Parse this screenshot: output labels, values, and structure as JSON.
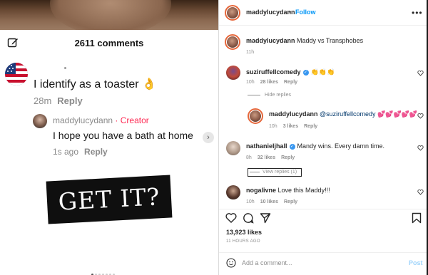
{
  "tiktok": {
    "comments_count": "2611 comments",
    "comment1": {
      "text": "I identify as a toaster 👌",
      "time": "28m",
      "reply_label": "Reply"
    },
    "comment2": {
      "author": "maddylucydann",
      "creator_label": "· Creator",
      "text": "I hope you have a bath at home",
      "time": "1s ago",
      "reply_label": "Reply"
    },
    "overlay_text": "GET IT?"
  },
  "instagram": {
    "header": {
      "username": "maddylucydann",
      "separator": "•",
      "follow_label": "Follow"
    },
    "caption": {
      "username": "maddylucydann",
      "text": "Maddy vs Transphobes",
      "time": "11h"
    },
    "comments": [
      {
        "username": "suziruffellcomedy",
        "text": "👏👏👏",
        "time": "10h",
        "likes": "28 likes",
        "reply_label": "Reply",
        "toggle": "Hide replies"
      },
      {
        "username": "maddylucydann",
        "text": "@suziruffellcomedy 💕💕💕💕💕",
        "time": "10h",
        "likes": "3 likes",
        "reply_label": "Reply"
      },
      {
        "username": "nathanieljhall",
        "text": "Mandy wins. Every damn time.",
        "time": "8h",
        "likes": "32 likes",
        "reply_label": "Reply",
        "toggle": "View replies (1)"
      },
      {
        "username": "nogalivne",
        "text": "Love this Maddy!!!",
        "time": "10h",
        "likes": "10 likes",
        "reply_label": "Reply"
      }
    ],
    "likes_count": "13,923 likes",
    "time_ago": "11 HOURS AGO",
    "add_comment_placeholder": "Add a comment...",
    "post_label": "Post"
  },
  "colors": {
    "tiktok_creator": "#fe2c55",
    "ig_blue": "#0095f6",
    "ig_post_disabled": "#9fd4fb"
  }
}
